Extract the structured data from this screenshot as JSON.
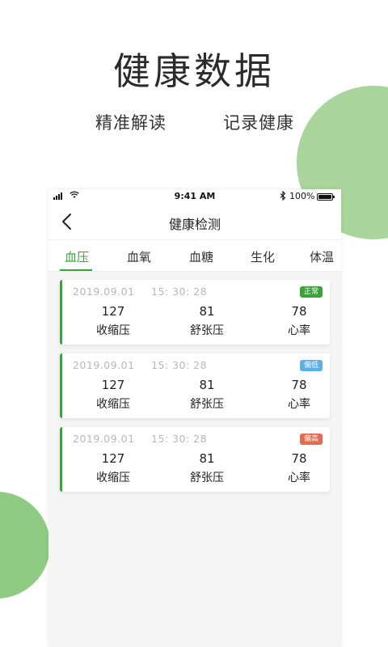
{
  "hero": {
    "title": "健康数据",
    "subtitle_left": "精准解读",
    "subtitle_right": "记录健康"
  },
  "colors": {
    "accent": "#3aa33a",
    "circle_light": "#a9d59c",
    "circle_dark": "#8fcb83",
    "badge_normal": "#3aa33a",
    "badge_low": "#5bb0e6",
    "badge_high": "#e86a4e"
  },
  "statusbar": {
    "time": "9:41 AM",
    "battery": "100%",
    "icons": [
      "signal-icon",
      "wifi-icon",
      "bluetooth-icon",
      "battery-icon"
    ]
  },
  "navbar": {
    "title": "健康检测",
    "back_icon": "chevron-left-icon"
  },
  "tabs": [
    {
      "label": "血压",
      "active": true
    },
    {
      "label": "血氧",
      "active": false
    },
    {
      "label": "血糖",
      "active": false
    },
    {
      "label": "生化",
      "active": false
    },
    {
      "label": "体温",
      "active": false
    }
  ],
  "records": [
    {
      "date": "2019.09.01",
      "time": "15: 30: 28",
      "status": "正常",
      "status_color": "#3aa33a",
      "systolic": "127",
      "systolic_label": "收缩压",
      "diastolic": "81",
      "diastolic_label": "舒张压",
      "heart_rate": "78",
      "heart_rate_label": "心率"
    },
    {
      "date": "2019.09.01",
      "time": "15: 30: 28",
      "status": "偏低",
      "status_color": "#5bb0e6",
      "systolic": "127",
      "systolic_label": "收缩压",
      "diastolic": "81",
      "diastolic_label": "舒张压",
      "heart_rate": "78",
      "heart_rate_label": "心率"
    },
    {
      "date": "2019.09.01",
      "time": "15: 30: 28",
      "status": "偏高",
      "status_color": "#e86a4e",
      "systolic": "127",
      "systolic_label": "收缩压",
      "diastolic": "81",
      "diastolic_label": "舒张压",
      "heart_rate": "78",
      "heart_rate_label": "心率"
    }
  ]
}
